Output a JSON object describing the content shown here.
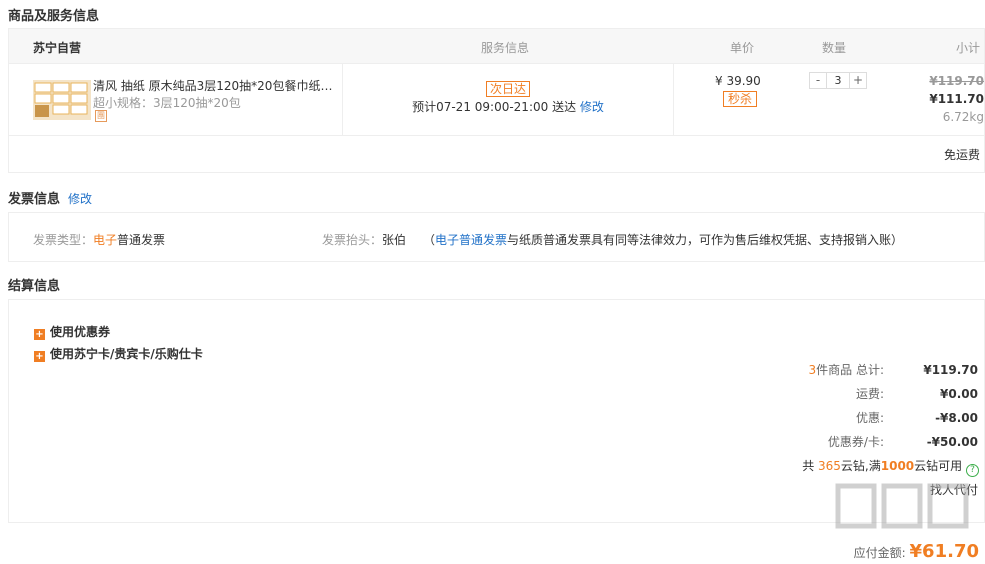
{
  "goods_section": {
    "title": "商品及服务信息",
    "headers": {
      "store": "苏宁自营",
      "service": "服务信息",
      "unit_price": "单价",
      "quantity": "数量",
      "subtotal": "小计"
    },
    "item": {
      "name": "清风 抽纸 原木纯品3层120抽*20包餐巾纸 ...",
      "spec": "超小规格：3层120抽*20包",
      "badge": "團",
      "delivery_tag": "次日达",
      "delivery_prefix": "预计07-21 09:00-21:00 送达",
      "delivery_edit": "修改",
      "price": "¥ 39.90",
      "flash_tag": "秒杀",
      "qty_minus": "-",
      "qty": "3",
      "qty_plus": "+",
      "original_subtotal": "¥119.70",
      "subtotal": "¥111.70",
      "weight": "6.72kg"
    },
    "shipping": "免运费"
  },
  "invoice_section": {
    "title": "发票信息",
    "edit": "修改",
    "type_label": "发票类型：",
    "type_highlight": "电子",
    "type_value": "普通发票",
    "head_label": "发票抬头：",
    "head_value": "张伯",
    "note_open": "（",
    "note_link": "电子普通发票",
    "note_rest": "与纸质普通发票具有同等法律效力，可作为售后维权凭据、支持报销入账）"
  },
  "settle_section": {
    "title": "结算信息",
    "options": [
      "使用优惠券",
      "使用苏宁卡/贵宾卡/乐购仕卡"
    ],
    "summary": {
      "items_count": "3",
      "items_label": "件商品 总计:",
      "items_total": "¥119.70",
      "freight_label": "运费:",
      "freight": "¥0.00",
      "discount_label": "优惠:",
      "discount": "-¥8.00",
      "coupon_label": "优惠券/卡:",
      "coupon": "-¥50.00"
    },
    "cloud": {
      "p1": "共 ",
      "n1": "365",
      "p2": "云钻,满",
      "n2": "1000",
      "p3": "云钻可用",
      "q": "?"
    },
    "pay_for": "找人代付"
  },
  "total": {
    "label": "应付金额:",
    "value": "¥61.70"
  },
  "colors": {
    "accent": "#f07e23",
    "link": "#2272c8",
    "border": "#eeeeee"
  }
}
